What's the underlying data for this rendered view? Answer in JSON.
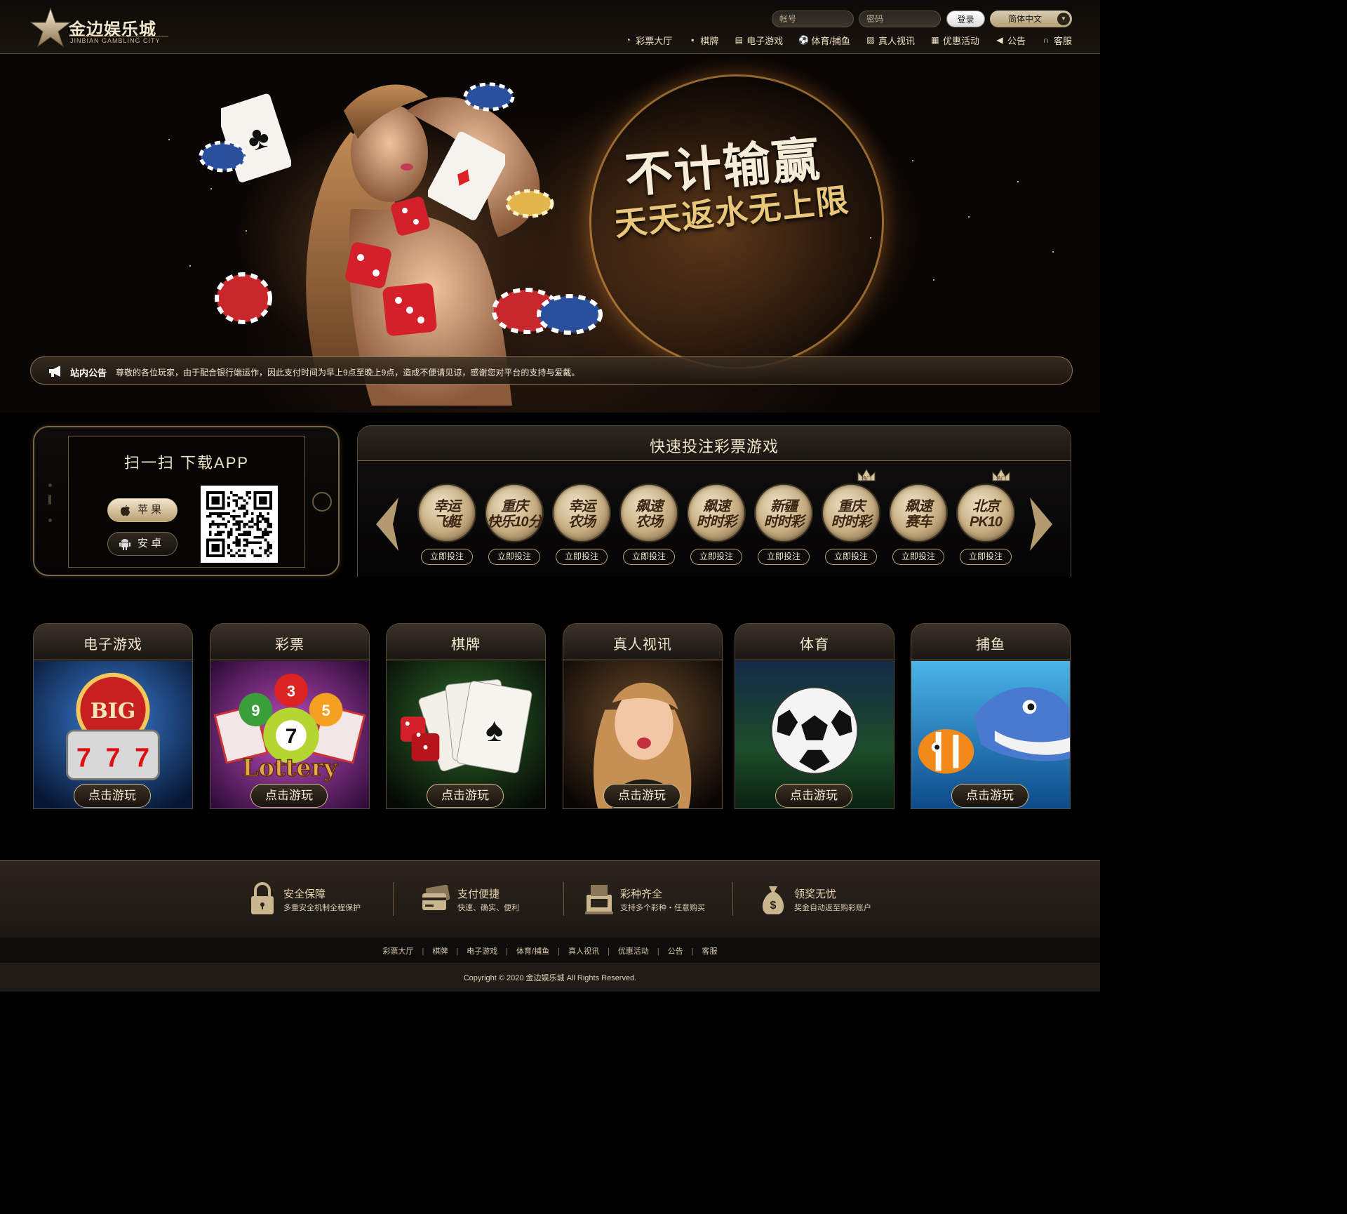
{
  "header": {
    "logo_name": "金边娱乐城",
    "logo_sub": "JINBIAN GAMBLING CITY",
    "login": {
      "username_placeholder": "帐号",
      "password_placeholder": "密码",
      "login_label": "登录",
      "language": "简体中文"
    },
    "nav": [
      {
        "label": "彩票大厅",
        "icon": "lottery-icon"
      },
      {
        "label": "棋牌",
        "icon": "card-icon"
      },
      {
        "label": "电子游戏",
        "icon": "slot-icon"
      },
      {
        "label": "体育/捕鱼",
        "icon": "soccer-icon"
      },
      {
        "label": "真人视讯",
        "icon": "live-icon"
      },
      {
        "label": "优惠活动",
        "icon": "gift-icon"
      },
      {
        "label": "公告",
        "icon": "megaphone-icon"
      },
      {
        "label": "客服",
        "icon": "headset-icon"
      }
    ]
  },
  "banner": {
    "slogan1": "不计输赢",
    "slogan2": "天天返水无上限"
  },
  "notice": {
    "title": "站内公告",
    "text": "尊敬的各位玩家，由于配合银行端运作，因此支付时间为早上9点至晚上9点，造成不便请见谅，感谢您对平台的支持与爱戴。"
  },
  "app": {
    "title": "扫一扫  下载APP",
    "apple_label": "苹 果",
    "android_label": "安 卓"
  },
  "quick": {
    "title": "快速投注彩票游戏",
    "bet_label": "立即投注",
    "hot_label": "热门",
    "games": [
      {
        "line1": "幸运",
        "line2": "飞艇",
        "hot": false
      },
      {
        "line1": "重庆",
        "line2": "快乐10分",
        "hot": false
      },
      {
        "line1": "幸运",
        "line2": "农场",
        "hot": false
      },
      {
        "line1": "飙速",
        "line2": "农场",
        "hot": false
      },
      {
        "line1": "飙速",
        "line2": "时时彩",
        "hot": false
      },
      {
        "line1": "新疆",
        "line2": "时时彩",
        "hot": false
      },
      {
        "line1": "重庆",
        "line2": "时时彩",
        "hot": true
      },
      {
        "line1": "飙速",
        "line2": "赛车",
        "hot": false
      },
      {
        "line1": "北京",
        "line2": "PK10",
        "hot": true
      }
    ]
  },
  "categories": {
    "play_label": "点击游玩",
    "items": [
      {
        "title": "电子游戏"
      },
      {
        "title": "彩票"
      },
      {
        "title": "棋牌"
      },
      {
        "title": "真人视讯"
      },
      {
        "title": "体育"
      },
      {
        "title": "捕鱼"
      }
    ],
    "slot_text": "BIG",
    "lottery_text": "Lottery"
  },
  "features": [
    {
      "title": "安全保障",
      "sub": "多重安全机制全程保护",
      "icon": "lock-icon"
    },
    {
      "title": "支付便捷",
      "sub": "快速、确实、便利",
      "icon": "card-payment-icon"
    },
    {
      "title": "彩种齐全",
      "sub": "支持多个彩种・任意购买",
      "icon": "register-icon"
    },
    {
      "title": "领奖无忧",
      "sub": "奖金自动返至购彩账户",
      "icon": "money-bag-icon"
    }
  ],
  "footer": {
    "links": [
      "彩票大厅",
      "棋牌",
      "电子游戏",
      "体育/捕鱼",
      "真人视讯",
      "优惠活动",
      "公告",
      "客服"
    ],
    "copyright": "Copyright © 2020 金边娱乐城 All Rights Reserved."
  }
}
